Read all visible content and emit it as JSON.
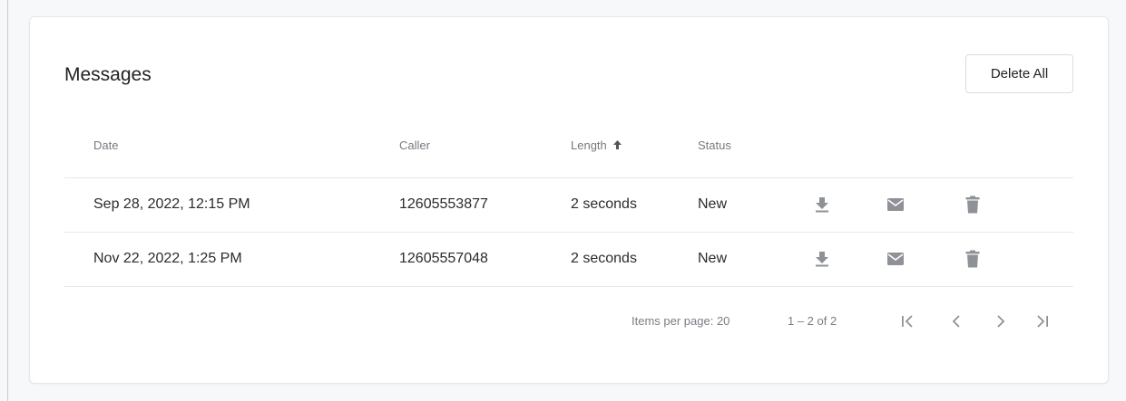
{
  "card": {
    "title": "Messages",
    "delete_all_label": "Delete All"
  },
  "table": {
    "columns": [
      {
        "label": "Date"
      },
      {
        "label": "Caller"
      },
      {
        "label": "Length",
        "sorted": "ascending"
      },
      {
        "label": "Status"
      }
    ],
    "rows": [
      {
        "date": "Sep 28, 2022, 12:15 PM",
        "caller": "12605553877",
        "length": "2 seconds",
        "status": "New"
      },
      {
        "date": "Nov 22, 2022, 1:25 PM",
        "caller": "12605557048",
        "length": "2 seconds",
        "status": "New"
      }
    ],
    "row_actions": [
      "download-icon",
      "email-icon",
      "trash-icon"
    ]
  },
  "paginator": {
    "items_per_page": "Items per page: 20",
    "range": "1 – 2 of 2",
    "buttons": [
      "first-page-icon",
      "previous-page-icon",
      "next-page-icon",
      "last-page-icon"
    ]
  },
  "colors": {
    "icon": "#8e9196",
    "border": "#e6e8eb",
    "muted_text": "#767a80"
  }
}
